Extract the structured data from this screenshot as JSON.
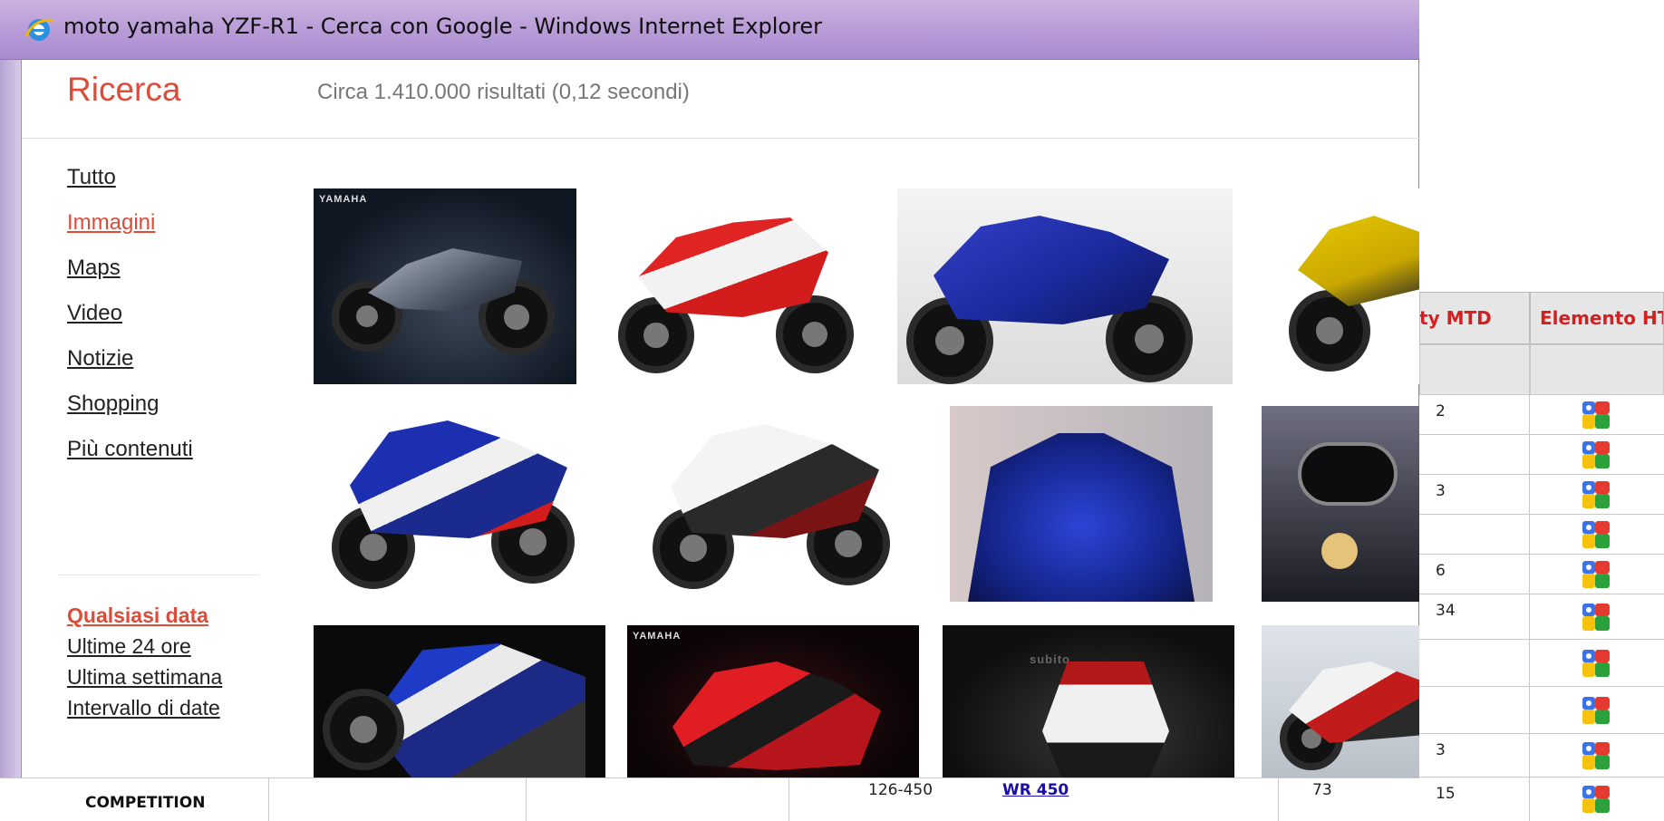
{
  "window": {
    "title": "moto yamaha YZF-R1 - Cerca con Google - Windows Internet Explorer"
  },
  "google": {
    "section_title": "Ricerca",
    "result_stats": "Circa 1.410.000 risultati (0,12 secondi)"
  },
  "nav": {
    "items": [
      {
        "label": "Tutto",
        "active": false
      },
      {
        "label": "Immagini",
        "active": true
      },
      {
        "label": "Maps",
        "active": false
      },
      {
        "label": "Video",
        "active": false
      },
      {
        "label": "Notizie",
        "active": false
      },
      {
        "label": "Shopping",
        "active": false
      },
      {
        "label": "Più contenuti",
        "active": false
      }
    ]
  },
  "time_filter": {
    "items": [
      {
        "label": "Qualsiasi data",
        "active": true
      },
      {
        "label": "Ultime 24 ore",
        "active": false
      },
      {
        "label": "Ultima settimana",
        "active": false
      },
      {
        "label": "Intervallo di date",
        "active": false
      }
    ]
  },
  "images": {
    "rows": [
      [
        {
          "icon": "yamaha-r1-black-studio-image",
          "caption": "YAMAHA"
        },
        {
          "icon": "yamaha-r1-red-white-image"
        },
        {
          "icon": "yamaha-r1-blue-showroom-image"
        },
        {
          "icon": "yamaha-r1-yellow-partial-image"
        }
      ],
      [
        {
          "icon": "yamaha-r1-fiat-livery-image"
        },
        {
          "icon": "yamaha-r1-white-black-image"
        },
        {
          "icon": "yamaha-r1-blue-front-closeup-image"
        },
        {
          "icon": "yamaha-r1-cockpit-image"
        }
      ],
      [
        {
          "icon": "yamaha-r1-exhaust-closeup-image"
        },
        {
          "icon": "yamaha-r1-red-black-image",
          "caption": "YAMAHA"
        },
        {
          "icon": "yamaha-r1-white-garage-image",
          "caption": "subito"
        },
        {
          "icon": "yamaha-r1-white-outdoor-image"
        }
      ]
    ]
  },
  "spreadsheet": {
    "headers": [
      "Qty MTD",
      "Elemento HTML"
    ],
    "rows": [
      {
        "qty": "2",
        "icon": "google-icon"
      },
      {
        "qty": "",
        "icon": "google-icon"
      },
      {
        "qty": "3",
        "icon": "google-icon"
      },
      {
        "qty": "",
        "icon": "google-icon"
      },
      {
        "qty": "6",
        "icon": "google-icon"
      },
      {
        "qty": "34",
        "icon": "google-icon"
      },
      {
        "qty": "",
        "icon": "google-icon"
      },
      {
        "qty": "",
        "icon": "google-icon"
      },
      {
        "qty": "3",
        "icon": "google-icon"
      },
      {
        "qty": "15",
        "icon": "google-icon"
      }
    ],
    "bottom_row": {
      "range": "126-450",
      "model_link": "WR 450",
      "value": "73",
      "qty": "15"
    },
    "category_label": "COMPETITION"
  }
}
